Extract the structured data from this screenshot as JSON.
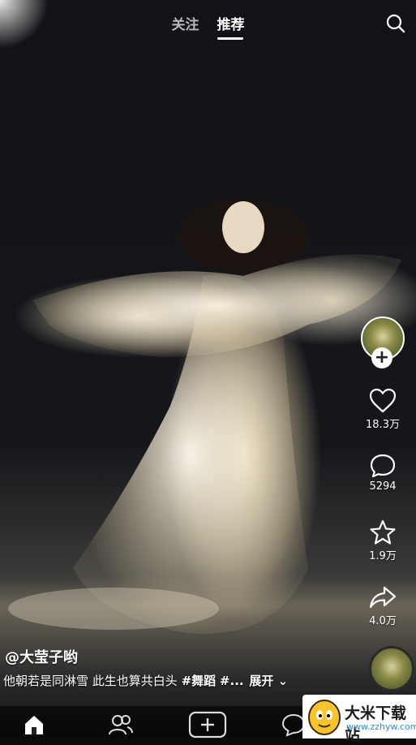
{
  "header": {
    "tabs": [
      {
        "label": "关注",
        "active": false
      },
      {
        "label": "推荐",
        "active": true
      }
    ],
    "search_icon": "search-icon"
  },
  "video": {
    "author": "@大莹子哟",
    "caption": "他朝若是同淋雪 此生也算共白头",
    "hashtags": [
      "#舞蹈",
      "#..."
    ],
    "expand_label": "展开"
  },
  "actions": {
    "follow_icon": "plus-icon",
    "like": {
      "icon": "heart-icon",
      "count": "18.3万"
    },
    "comment": {
      "icon": "comment-bubble-icon",
      "count": "5294"
    },
    "favorite": {
      "icon": "star-icon",
      "count": "1.9万"
    },
    "share": {
      "icon": "share-arrow-icon",
      "count": "4.0万"
    }
  },
  "bottom_nav": {
    "items": [
      {
        "icon": "home-icon",
        "active": true
      },
      {
        "icon": "friends-icon",
        "active": false
      },
      {
        "icon": "add-icon",
        "active": false
      },
      {
        "icon": "message-icon",
        "active": false
      }
    ]
  },
  "watermark": {
    "title": "大米下载站",
    "url": "www.zzhyw.com"
  },
  "colors": {
    "text": "#ffffff",
    "watermark_url": "#2e8ed8"
  }
}
